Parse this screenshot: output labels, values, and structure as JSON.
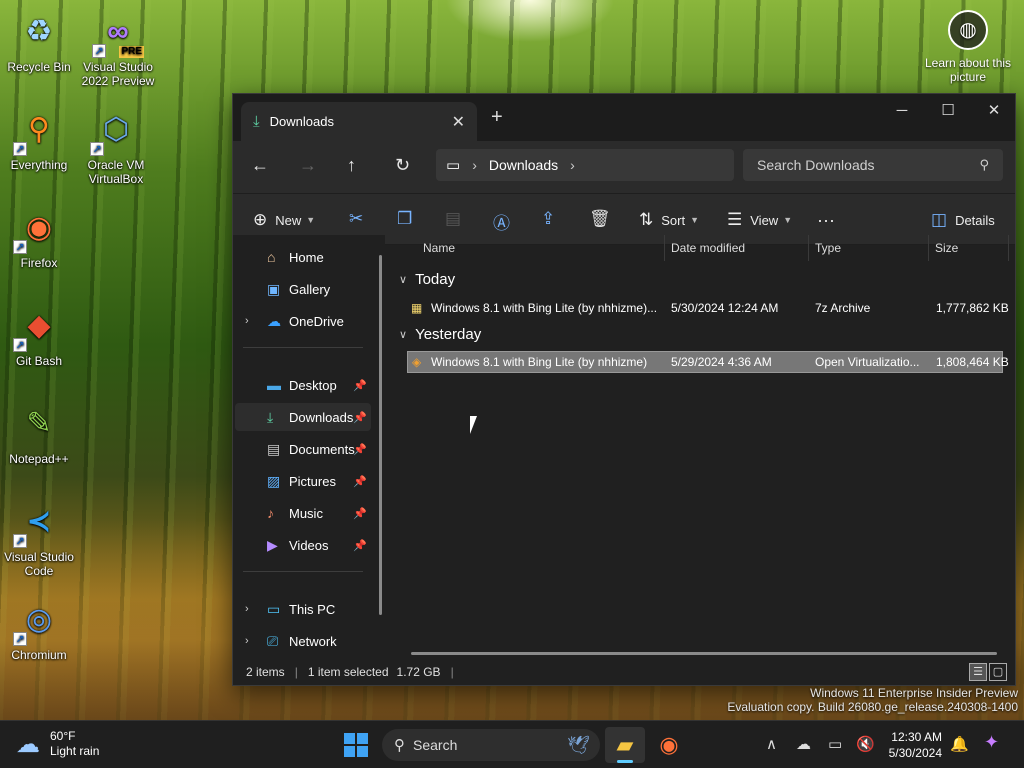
{
  "desktop": {
    "icons": [
      {
        "label": "Recycle Bin"
      },
      {
        "label": "Visual Studio 2022 Preview",
        "badge": "PRE"
      },
      {
        "label": "Everything"
      },
      {
        "label": "Oracle VM VirtualBox"
      },
      {
        "label": "Firefox"
      },
      {
        "label": "Git Bash"
      },
      {
        "label": "Notepad++"
      },
      {
        "label": "Visual Studio Code"
      },
      {
        "label": "Chromium"
      }
    ],
    "learn_label": "Learn about this picture",
    "watermark_line1": "Windows 11 Enterprise Insider Preview",
    "watermark_line2": "Evaluation copy. Build 26080.ge_release.240308-1400"
  },
  "explorer": {
    "tab_title": "Downloads",
    "address": {
      "segment": "Downloads"
    },
    "search_placeholder": "Search Downloads",
    "commands": {
      "new": "New",
      "sort": "Sort",
      "view": "View",
      "details": "Details"
    },
    "nav": {
      "home": "Home",
      "gallery": "Gallery",
      "onedrive": "OneDrive",
      "desktop": "Desktop",
      "downloads": "Downloads",
      "documents": "Documents",
      "pictures": "Pictures",
      "music": "Music",
      "videos": "Videos",
      "thispc": "This PC",
      "network": "Network"
    },
    "columns": {
      "name": "Name",
      "date": "Date modified",
      "type": "Type",
      "size": "Size"
    },
    "groups": [
      {
        "label": "Today",
        "files": [
          {
            "name": "Windows 8.1 with Bing Lite (by nhhizme)...",
            "date": "5/30/2024 12:24 AM",
            "type": "7z Archive",
            "size": "1,777,862 KB"
          }
        ]
      },
      {
        "label": "Yesterday",
        "files": [
          {
            "name": "Windows 8.1 with Bing Lite (by nhhizme)",
            "date": "5/29/2024 4:36 AM",
            "type": "Open Virtualizatio...",
            "size": "1,808,464 KB"
          }
        ]
      }
    ],
    "status": {
      "items": "2 items",
      "selected": "1 item selected",
      "size": "1.72 GB"
    }
  },
  "taskbar": {
    "weather_temp": "60°F",
    "weather_desc": "Light rain",
    "search_label": "Search",
    "time": "12:30 AM",
    "date": "5/30/2024"
  },
  "colors": {
    "accent": "#60cdff",
    "window_bg": "#202020",
    "toolbar_bg": "#2b2b2b",
    "selection": "#777777"
  }
}
